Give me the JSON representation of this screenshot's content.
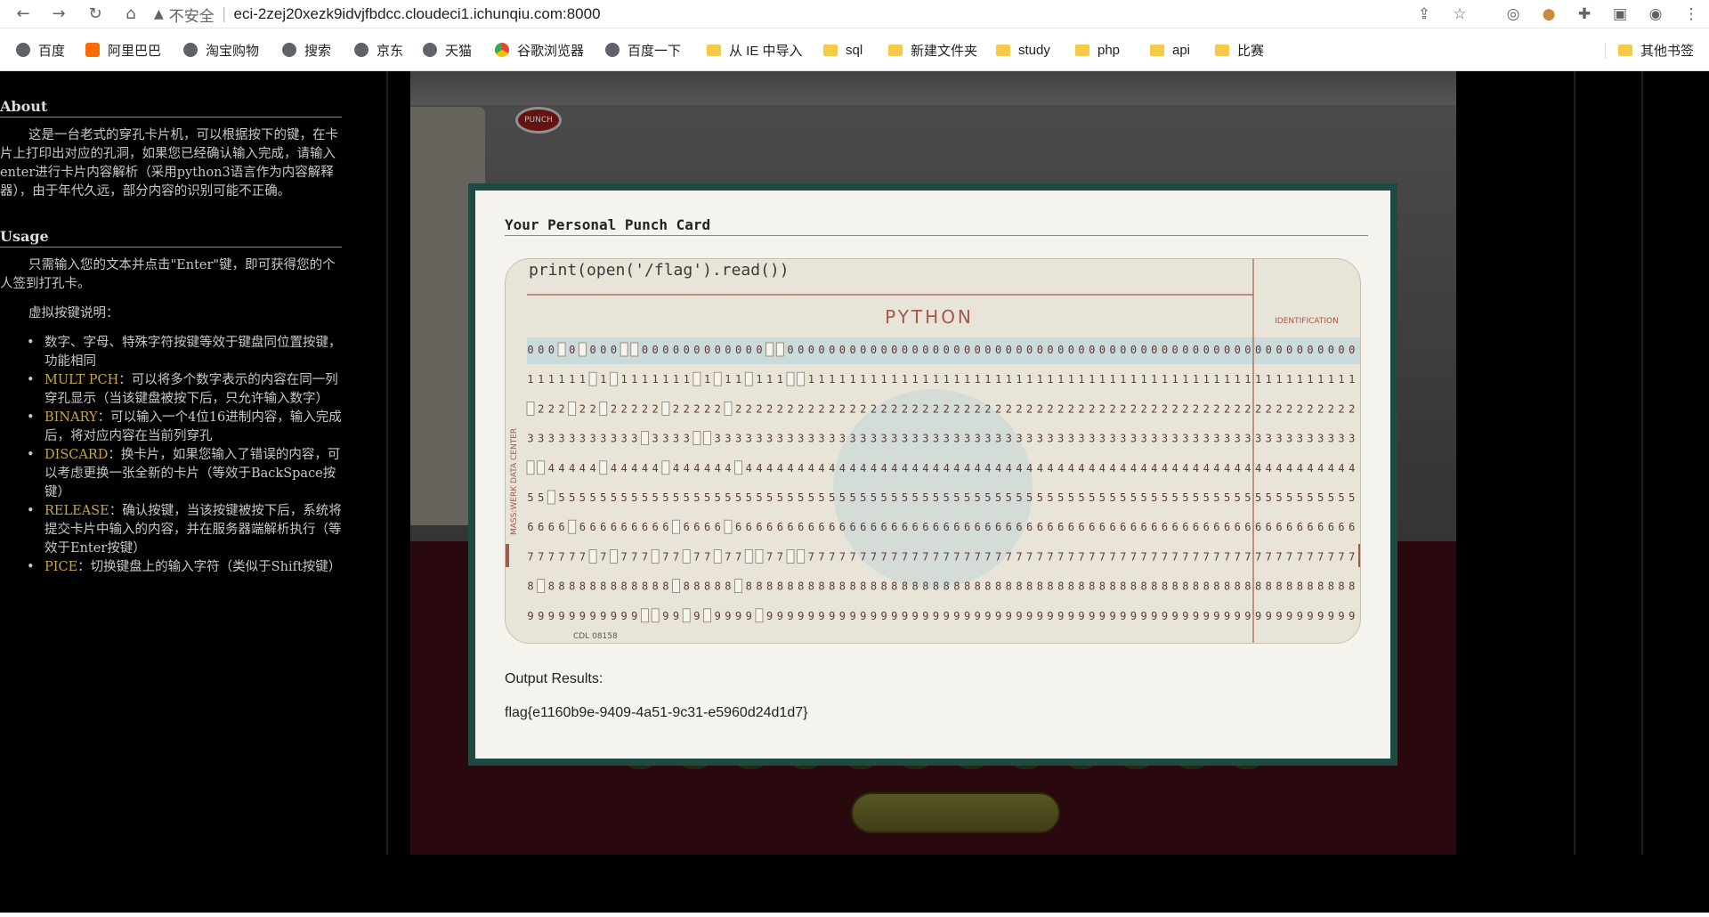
{
  "browser": {
    "security_label": "不安全",
    "url": "eci-2zej20xezk9idvjfbdcc.cloudeci1.ichunqiu.com:8000",
    "nav": [
      "back",
      "forward",
      "reload",
      "home"
    ],
    "toolbar_icons": [
      "share-icon",
      "star-icon",
      "extension-circle-icon",
      "cookie-icon",
      "puzzle-icon",
      "sidepanel-icon",
      "profile-icon",
      "menu-icon"
    ]
  },
  "bookmarks": [
    {
      "label": "百度",
      "icon": "globe"
    },
    {
      "label": "阿里巴巴",
      "icon": "ali"
    },
    {
      "label": "淘宝购物",
      "icon": "globe"
    },
    {
      "label": "搜索",
      "icon": "globe"
    },
    {
      "label": "京东",
      "icon": "globe"
    },
    {
      "label": "天猫",
      "icon": "globe"
    },
    {
      "label": "谷歌浏览器",
      "icon": "chrome"
    },
    {
      "label": "百度一下",
      "icon": "globe"
    },
    {
      "label": "从 IE 中导入",
      "icon": "folder"
    },
    {
      "label": "sql",
      "icon": "folder"
    },
    {
      "label": "新建文件夹",
      "icon": "folder"
    },
    {
      "label": "study",
      "icon": "folder"
    },
    {
      "label": "php",
      "icon": "folder"
    },
    {
      "label": "api",
      "icon": "folder"
    },
    {
      "label": "比赛",
      "icon": "folder"
    },
    {
      "label": "其他书签",
      "icon": "folder"
    }
  ],
  "sidebar": {
    "about_title": "About",
    "about_text": "这是一台老式的穿孔卡片机，可以根据按下的键，在卡片上打印出对应的孔洞，如果您已经确认输入完成，请输入enter进行卡片内容解析（采用python3语言作为内容解释器），由于年代久远，部分内容的识别可能不正确。",
    "usage_title": "Usage",
    "usage_text": "只需输入您的文本并点击\"Enter\"键，即可获得您的个人签到打孔卡。",
    "keys_intro": "虚拟按键说明：",
    "keys": [
      {
        "key": "",
        "desc": "数字、字母、特殊字符按键等效于键盘同位置按键，功能相同"
      },
      {
        "key": "MULT PCH",
        "desc": "：可以将多个数字表示的内容在同一列穿孔显示（当该键盘被按下后，只允许输入数字）"
      },
      {
        "key": "BINARY",
        "desc": "：可以输入一个4位16进制内容，输入完成后，将对应内容在当前列穿孔"
      },
      {
        "key": "DISCARD",
        "desc": "：换卡片，如果您输入了错误的内容，可以考虑更换一张全新的卡片（等效于BackSpace按键）"
      },
      {
        "key": "RELEASE",
        "desc": "：确认按键，当该按键被按下后，系统将提交卡片中输入的内容，并在服务器端解析执行（等效于Enter按键）"
      },
      {
        "key": "PICE",
        "desc": "：切换键盘上的输入字符（类似于Shift按键）"
      }
    ]
  },
  "machine": {
    "punch_label": "PUNCH"
  },
  "modal": {
    "title": "Your Personal Punch Card",
    "card": {
      "printed_text": "print(open('/flag').read())",
      "language": "PYTHON",
      "identification": "IDENTIFICATION",
      "side_text": "MASS:WERK DATA CENTER",
      "footer": "CDL   08158",
      "columns": 80,
      "rows": [
        "0",
        "1",
        "2",
        "3",
        "4",
        "5",
        "6",
        "7",
        "8",
        "9"
      ]
    },
    "output_label": "Output Results:",
    "output_value": "flag{e1160b9e-9409-4a51-9c31-e5960d24d1d7}"
  }
}
